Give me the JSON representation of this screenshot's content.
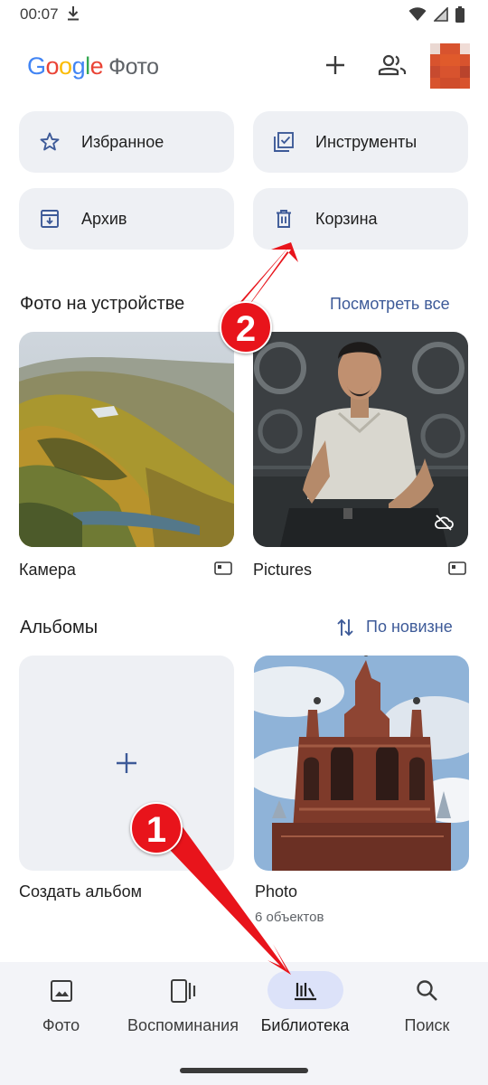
{
  "status_bar": {
    "time": "00:07",
    "icons": [
      "download-icon",
      "wifi-icon",
      "no-signal-icon",
      "battery-icon"
    ]
  },
  "header": {
    "logo_letters": [
      "G",
      "o",
      "o",
      "g",
      "l",
      "e"
    ],
    "product": "Фото",
    "icons": [
      "add-icon",
      "people-icon"
    ]
  },
  "quick_buttons": [
    {
      "label": "Избранное",
      "icon": "star-icon"
    },
    {
      "label": "Инструменты",
      "icon": "tools-checklist-icon"
    },
    {
      "label": "Архив",
      "icon": "archive-icon"
    },
    {
      "label": "Корзина",
      "icon": "trash-icon"
    }
  ],
  "device_section": {
    "title": "Фото на устройстве",
    "link": "Посмотреть все",
    "folders": [
      {
        "name": "Камера",
        "badge_icon": "device-folder-icon"
      },
      {
        "name": "Pictures",
        "badge_icon": "device-folder-icon",
        "overlay_icon": "cloud-off-icon"
      }
    ]
  },
  "albums_section": {
    "title": "Альбомы",
    "sort_label": "По новизне",
    "sort_icon": "sort-arrows-icon",
    "create_label": "Создать альбом",
    "albums": [
      {
        "name": "Photo",
        "count": "6 объектов"
      }
    ]
  },
  "bottom_nav": {
    "items": [
      {
        "label": "Фото",
        "icon": "photo-icon"
      },
      {
        "label": "Воспоминания",
        "icon": "memories-icon"
      },
      {
        "label": "Библиотека",
        "icon": "library-icon",
        "active": true
      },
      {
        "label": "Поиск",
        "icon": "search-icon"
      }
    ]
  },
  "annotations": {
    "marker_1": "1",
    "marker_2": "2"
  },
  "colors": {
    "accent": "#3d5a98",
    "chip_bg": "#eef0f4",
    "nav_pill": "#dce2f9",
    "marker": "#e8141b"
  }
}
